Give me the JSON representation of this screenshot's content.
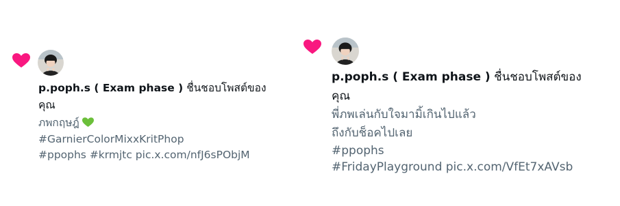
{
  "colors": {
    "heart": "#f91880",
    "name": "#0f1419",
    "text": "#536471",
    "green_heart": "#6bbf3a"
  },
  "notifications": [
    {
      "icon": "heart-icon",
      "avatar": "avatar",
      "username": "p.poph.s ( Exam phase )",
      "action": "ชื่นชอบโพสต์ของ",
      "action_cont": "คุณ",
      "lines": [
        "ภพกฤษฎ์",
        "#GarnierColorMixxKritPhop",
        "#ppophs #krmjtc pic.x.com/nfJ6sPObjM"
      ],
      "emoji": "green-heart-icon"
    },
    {
      "icon": "heart-icon",
      "avatar": "avatar",
      "username": "p.poph.s ( Exam phase )",
      "action": "ชื่นชอบโพสต์ของ",
      "action_cont": "คุณ",
      "lines": [
        "พี่ภพเล่นกับใจมามิ้เกินไปแล้ว",
        "ถึงกับช็อคไปเลย",
        "#ppophs",
        "#FridayPlayground pic.x.com/VfEt7xAVsb"
      ]
    }
  ]
}
